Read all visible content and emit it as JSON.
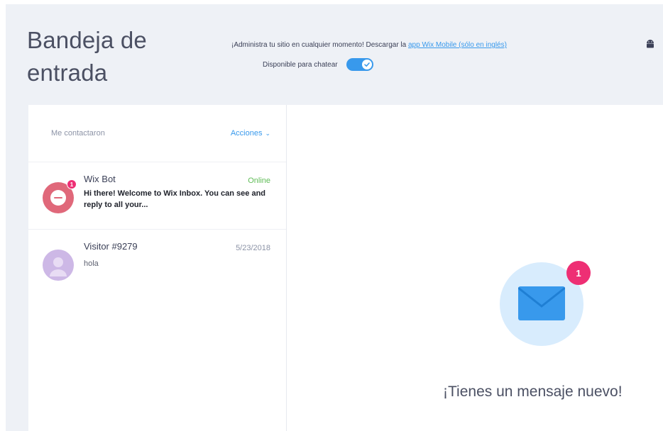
{
  "header": {
    "title": "Bandeja de entrada",
    "promo_text": "¡Administra tu sitio en cualquier momento! Descargar la ",
    "promo_link": "app Wix Mobile (sólo en inglés)",
    "chat_toggle_label": "Disponible para chatear",
    "chat_available": true
  },
  "list": {
    "filter_label": "Me contactaron",
    "actions_label": "Acciones",
    "conversations": [
      {
        "name": "Wix Bot",
        "meta": "Online",
        "preview": "Hi there! Welcome to Wix Inbox. You can see and reply to all your...",
        "unread_count": "1",
        "avatar_color": "#e0687a",
        "meta_color": "#60bc57"
      },
      {
        "name": "Visitor #9279",
        "meta": "5/23/2018",
        "preview": "hola",
        "avatar_color": "#cdb8e6",
        "meta_color": "#8c93a6"
      }
    ]
  },
  "detail": {
    "badge_count": "1",
    "empty_message": "¡Tienes un mensaje nuevo!"
  },
  "colors": {
    "accent": "#3899ec",
    "badge": "#ee2f74",
    "online": "#60bc57",
    "background": "#eef1f6"
  }
}
